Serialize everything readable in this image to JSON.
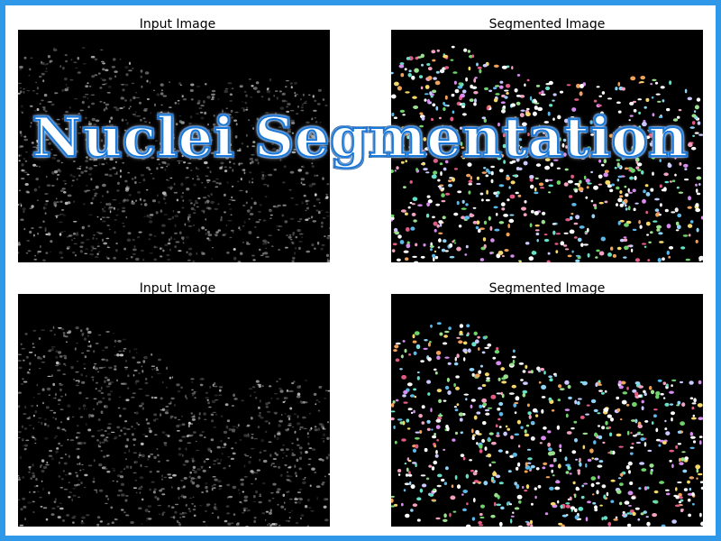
{
  "overlay_title": "Nuclei Segmentation",
  "colors": {
    "frame": "#2f98e8",
    "title_fill": "#ffffff",
    "title_outline": "#1a78d8"
  },
  "rows": [
    {
      "input_title": "Input Image",
      "segmented_title": "Segmented Image"
    },
    {
      "input_title": "Input Image",
      "segmented_title": "Segmented Image"
    }
  ]
}
